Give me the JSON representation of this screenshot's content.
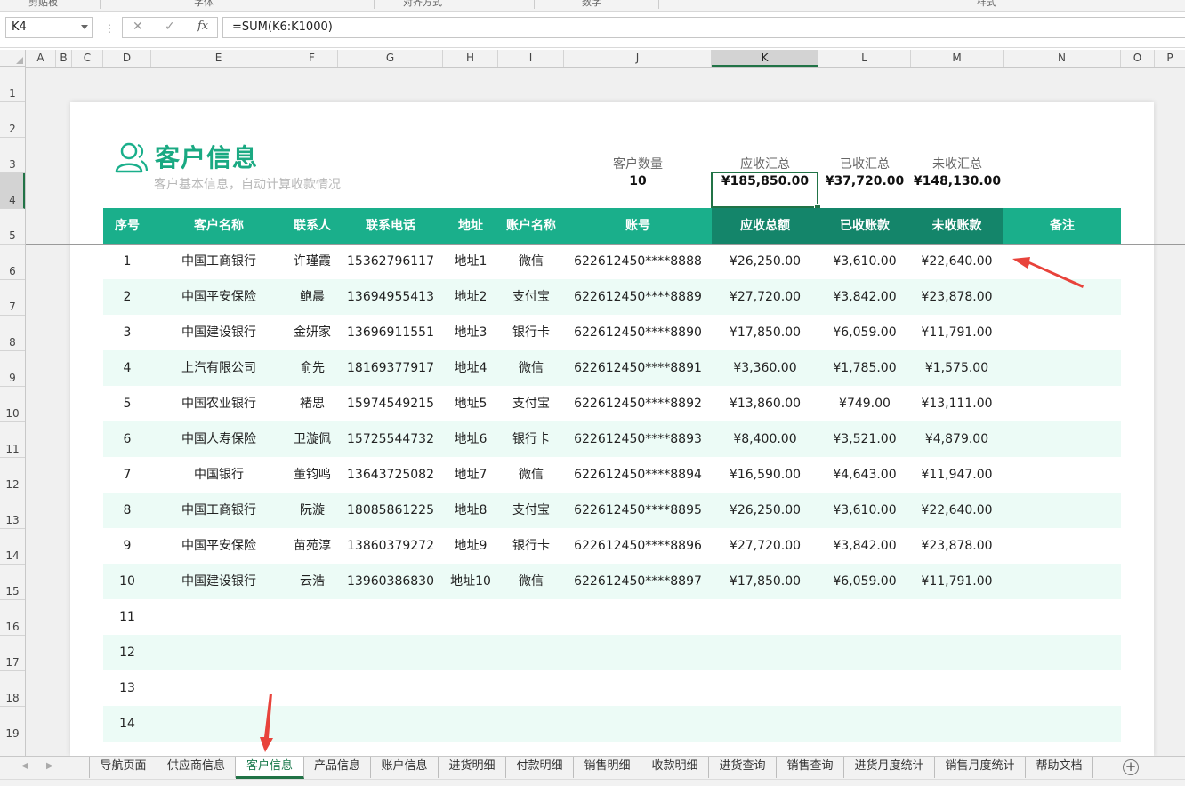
{
  "ribbon": {
    "groups": [
      "剪贴板",
      "字体",
      "对齐方式",
      "数字",
      "样式"
    ]
  },
  "formula_bar": {
    "name_box": "K4",
    "cancel_symbol": "✕",
    "enter_symbol": "✓",
    "fx_symbol": "fx",
    "formula": "=SUM(K6:K1000)"
  },
  "columns": [
    "A",
    "B",
    "C",
    "D",
    "E",
    "F",
    "G",
    "H",
    "I",
    "J",
    "K",
    "L",
    "M",
    "N",
    "O",
    "P"
  ],
  "rows": [
    "1",
    "2",
    "3",
    "4",
    "5",
    "6",
    "7",
    "8",
    "9",
    "10",
    "11",
    "12",
    "13",
    "14",
    "15",
    "16",
    "17",
    "18",
    "19"
  ],
  "title": "客户信息",
  "subtitle": "客户基本信息，自动计算收款情况",
  "summary": [
    {
      "label": "客户数量",
      "value": "10"
    },
    {
      "label": "应收汇总",
      "value": "¥185,850.00"
    },
    {
      "label": "已收汇总",
      "value": "¥37,720.00"
    },
    {
      "label": "未收汇总",
      "value": "¥148,130.00"
    }
  ],
  "table": {
    "headers": [
      "序号",
      "客户名称",
      "联系人",
      "联系电话",
      "地址",
      "账户名称",
      "账号",
      "应收总额",
      "已收账款",
      "未收账款",
      "备注"
    ],
    "rows": [
      [
        "1",
        "中国工商银行",
        "许瑾霞",
        "15362796117",
        "地址1",
        "微信",
        "622612450****8888",
        "¥26,250.00",
        "¥3,610.00",
        "¥22,640.00",
        ""
      ],
      [
        "2",
        "中国平安保险",
        "鲍晨",
        "13694955413",
        "地址2",
        "支付宝",
        "622612450****8889",
        "¥27,720.00",
        "¥3,842.00",
        "¥23,878.00",
        ""
      ],
      [
        "3",
        "中国建设银行",
        "金妍家",
        "13696911551",
        "地址3",
        "银行卡",
        "622612450****8890",
        "¥17,850.00",
        "¥6,059.00",
        "¥11,791.00",
        ""
      ],
      [
        "4",
        "上汽有限公司",
        "俞先",
        "18169377917",
        "地址4",
        "微信",
        "622612450****8891",
        "¥3,360.00",
        "¥1,785.00",
        "¥1,575.00",
        ""
      ],
      [
        "5",
        "中国农业银行",
        "褚思",
        "15974549215",
        "地址5",
        "支付宝",
        "622612450****8892",
        "¥13,860.00",
        "¥749.00",
        "¥13,111.00",
        ""
      ],
      [
        "6",
        "中国人寿保险",
        "卫漩佩",
        "15725544732",
        "地址6",
        "银行卡",
        "622612450****8893",
        "¥8,400.00",
        "¥3,521.00",
        "¥4,879.00",
        ""
      ],
      [
        "7",
        "中国银行",
        "董钧鸣",
        "13643725082",
        "地址7",
        "微信",
        "622612450****8894",
        "¥16,590.00",
        "¥4,643.00",
        "¥11,947.00",
        ""
      ],
      [
        "8",
        "中国工商银行",
        "阮漩",
        "18085861225",
        "地址8",
        "支付宝",
        "622612450****8895",
        "¥26,250.00",
        "¥3,610.00",
        "¥22,640.00",
        ""
      ],
      [
        "9",
        "中国平安保险",
        "苗苑淳",
        "13860379272",
        "地址9",
        "银行卡",
        "622612450****8896",
        "¥27,720.00",
        "¥3,842.00",
        "¥23,878.00",
        ""
      ],
      [
        "10",
        "中国建设银行",
        "云浩",
        "13960386830",
        "地址10",
        "微信",
        "622612450****8897",
        "¥17,850.00",
        "¥6,059.00",
        "¥11,791.00",
        ""
      ],
      [
        "11",
        "",
        "",
        "",
        "",
        "",
        "",
        "",
        "",
        "",
        ""
      ],
      [
        "12",
        "",
        "",
        "",
        "",
        "",
        "",
        "",
        "",
        "",
        ""
      ],
      [
        "13",
        "",
        "",
        "",
        "",
        "",
        "",
        "",
        "",
        "",
        ""
      ],
      [
        "14",
        "",
        "",
        "",
        "",
        "",
        "",
        "",
        "",
        "",
        ""
      ]
    ]
  },
  "sheet_tabs": [
    "导航页面",
    "供应商信息",
    "客户信息",
    "产品信息",
    "账户信息",
    "进货明细",
    "付款明细",
    "销售明细",
    "收款明细",
    "进货查询",
    "销售查询",
    "进货月度统计",
    "销售月度统计",
    "帮助文档"
  ],
  "active_tab": "客户信息",
  "colors": {
    "accent": "#1aaf8b",
    "accent_dark": "#14856a",
    "alt_row": "#ecfbf6",
    "excel_green": "#217346",
    "arrow": "#e8433b"
  }
}
